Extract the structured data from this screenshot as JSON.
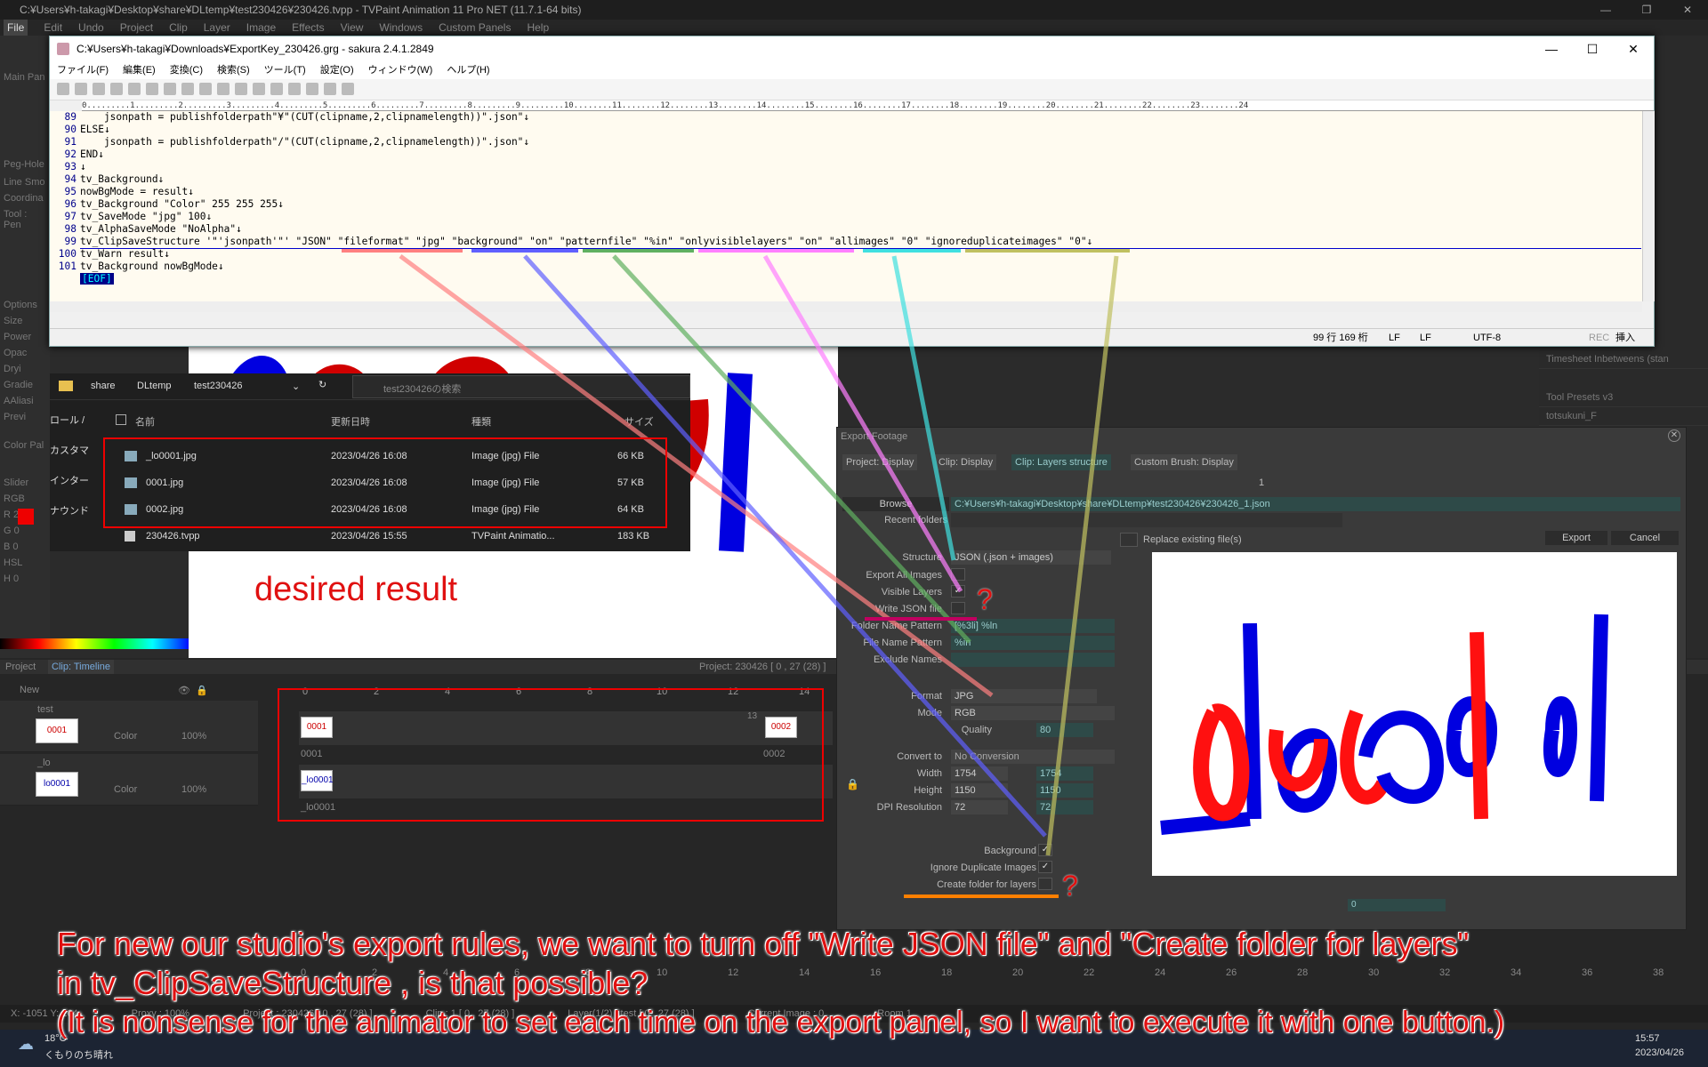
{
  "tvpaint": {
    "title": "C:¥Users¥h-takagi¥Desktop¥share¥DLtemp¥test230426¥230426.tvpp - TVPaint Animation 11 Pro NET (11.7.1-64 bits)",
    "menu": [
      "File",
      "Edit",
      "Undo",
      "Project",
      "Clip",
      "Layer",
      "Image",
      "Effects",
      "View",
      "Windows",
      "Custom Panels",
      "Help"
    ],
    "left_panel": [
      "Main Pan",
      "",
      "Peg-Hole",
      "Line Smo",
      "Coordina",
      "Tool : Pen",
      "",
      "Options",
      "Size",
      "Power",
      "Opac",
      "Dryi",
      "Gradie",
      "AAliasi",
      "Previ",
      "Color Pal",
      "",
      "Slider",
      "RGB",
      "R 255",
      "G 0",
      "B 0",
      "HSL",
      "H 0"
    ],
    "right_panel": [
      "Timesheet Inbetweens (stan",
      "Tool Presets v3",
      "totsukuni_F"
    ],
    "project_tab": "Project",
    "clip_tab": "Clip: Timeline",
    "project_info": "Project: 230426 [ 0 , 27  (28) ]",
    "layers": [
      {
        "name": "test",
        "color": "Color",
        "opacity": "100%",
        "thumb": "0001"
      },
      {
        "name": "_lo",
        "color": "Color",
        "opacity": "100%",
        "thumb": "lo0001"
      }
    ],
    "frame_numbers": [
      "0",
      "2",
      "4",
      "6",
      "8",
      "10",
      "12",
      "14"
    ],
    "frame_label_13": "13",
    "instances": [
      "0001",
      "0002",
      "_lo0001"
    ],
    "bottom_ruler": [
      "0",
      "2",
      "4",
      "6",
      "8",
      "10",
      "12",
      "14",
      "16",
      "18",
      "20",
      "22",
      "24",
      "26",
      "28",
      "30",
      "32",
      "34",
      "36",
      "38"
    ],
    "status": {
      "coords": "X: -1051  Y: 164",
      "proxy": "Proxy : 100%",
      "project": "Project : 230426 [ 0 , 27  (28) ]",
      "clip": "Clip : 1 [ 0 , 27  (28) ]",
      "layer": "Layer(1/2) : test [ 0 , 27  (28) ]",
      "current": "Current Image : 0",
      "room": "Room 1"
    },
    "new_layer": "New"
  },
  "sakura": {
    "title": "C:¥Users¥h-takagi¥Downloads¥ExportKey_230426.grg - sakura 2.4.1.2849",
    "menu": [
      "ファイル(F)",
      "編集(E)",
      "変換(C)",
      "検索(S)",
      "ツール(T)",
      "設定(O)",
      "ウィンドウ(W)",
      "ヘルプ(H)"
    ],
    "ruler": "0.........1.........2.........3.........4.........5.........6.........7.........8.........9.........10........11........12........13........14........15........16........17........18........19........20........21........22........23........24",
    "lines": [
      {
        "n": "89",
        "t": "    jsonpath = publishfolderpath\"¥\"(CUT(clipname,2,clipnamelength))\".json\"↓"
      },
      {
        "n": "90",
        "t": "ELSE↓"
      },
      {
        "n": "91",
        "t": "    jsonpath = publishfolderpath\"/\"(CUT(clipname,2,clipnamelength))\".json\"↓"
      },
      {
        "n": "92",
        "t": "END↓"
      },
      {
        "n": "93",
        "t": "↓"
      },
      {
        "n": "94",
        "t": "tv_Background↓"
      },
      {
        "n": "95",
        "t": "nowBgMode = result↓"
      },
      {
        "n": "96",
        "t": "tv_Background \"Color\" 255 255 255↓"
      },
      {
        "n": "97",
        "t": "tv_SaveMode \"jpg\" 100↓"
      },
      {
        "n": "98",
        "t": "tv_AlphaSaveMode \"NoAlpha\"↓"
      },
      {
        "n": "99",
        "t": "tv_ClipSaveStructure '\"'jsonpath'\"' \"JSON\" \"fileformat\" \"jpg\" \"background\" \"on\" \"patternfile\" \"%in\" \"onlyvisiblelayers\" \"on\" \"allimages\" \"0\" \"ignoreduplicateimages\" \"0\"↓"
      },
      {
        "n": "100",
        "t": "tv_Warn result↓"
      },
      {
        "n": "101",
        "t": "tv_Background nowBgMode↓"
      }
    ],
    "eof": "[EOF]",
    "status": {
      "pos": "99 行  169 桁",
      "lf1": "LF",
      "lf2": "LF",
      "enc": "UTF-8",
      "rec": "REC",
      "ins": "挿入"
    }
  },
  "explorer": {
    "breadcrumb": [
      "share",
      "DLtemp",
      "test230426"
    ],
    "search_placeholder": "test230426の検索",
    "headers": [
      "名前",
      "更新日時",
      "種類",
      "サイズ"
    ],
    "files": [
      {
        "name": "_lo0001.jpg",
        "date": "2023/04/26 16:08",
        "type": "Image (jpg) File",
        "size": "66 KB"
      },
      {
        "name": "0001.jpg",
        "date": "2023/04/26 16:08",
        "type": "Image (jpg) File",
        "size": "57 KB"
      },
      {
        "name": "0002.jpg",
        "date": "2023/04/26 16:08",
        "type": "Image (jpg) File",
        "size": "64 KB"
      },
      {
        "name": "230426.tvpp",
        "date": "2023/04/26 15:55",
        "type": "TVPaint Animatio...",
        "size": "183 KB"
      }
    ],
    "left_nav": [
      "ロール /",
      "カスタマ",
      "インター",
      "ナウンド",
      "ント"
    ]
  },
  "export": {
    "title": "Export Footage",
    "tabs": [
      "Project: Display",
      "Clip: Display",
      "Clip: Layers structure",
      "Custom Brush: Display"
    ],
    "count": "1",
    "browse": "Browse",
    "path": "C:¥Users¥h-takagi¥Desktop¥share¥DLtemp¥test230426¥230426_1.json",
    "recent": "Recent folders",
    "replace": "Replace existing file(s)",
    "export_btn": "Export",
    "cancel_btn": "Cancel",
    "structure_label": "Structure",
    "structure": "JSON (.json + images)",
    "export_all": "Export All Images",
    "visible_layers": "Visible Layers",
    "write_json": "Write JSON file",
    "folder_pattern_label": "Folder Name Pattern",
    "folder_pattern": "[%3li] %ln",
    "file_pattern_label": "File Name Pattern",
    "file_pattern": "%in",
    "exclude_label": "Exclude Names",
    "format_label": "Format",
    "format": "JPG",
    "mode_label": "Mode",
    "mode": "RGB",
    "quality_label": "Quality",
    "quality": "80",
    "convert_label": "Convert to",
    "convert": "No Conversion",
    "width_label": "Width",
    "width": "1754",
    "height_label": "Height",
    "height": "1150",
    "dpi_label": "DPI Resolution",
    "dpi": "72",
    "background": "Background",
    "ignore_dup": "Ignore Duplicate Images",
    "create_folder": "Create folder for layers",
    "frame": "0"
  },
  "annotations": {
    "desired": "desired result",
    "line1": "For new our studio's export rules, we want to turn off \"Write JSON file\" and \"Create folder for layers\"",
    "line2": "in tv_ClipSaveStructure , is that possible?",
    "line3": "(It is nonsense for the animator to set each time on the export panel, so I want to execute it with one button.)",
    "qmark": "?"
  },
  "taskbar": {
    "weather": "18°C",
    "weather_desc": "くもりのち晴れ",
    "time": "15:57",
    "date": "2023/04/26"
  },
  "colors": {
    "red": "#e01010",
    "underline_colors": [
      "#ff8080",
      "#8080ff",
      "#80c080",
      "#ff80ff",
      "#40e0e0",
      "#c0c070"
    ]
  }
}
